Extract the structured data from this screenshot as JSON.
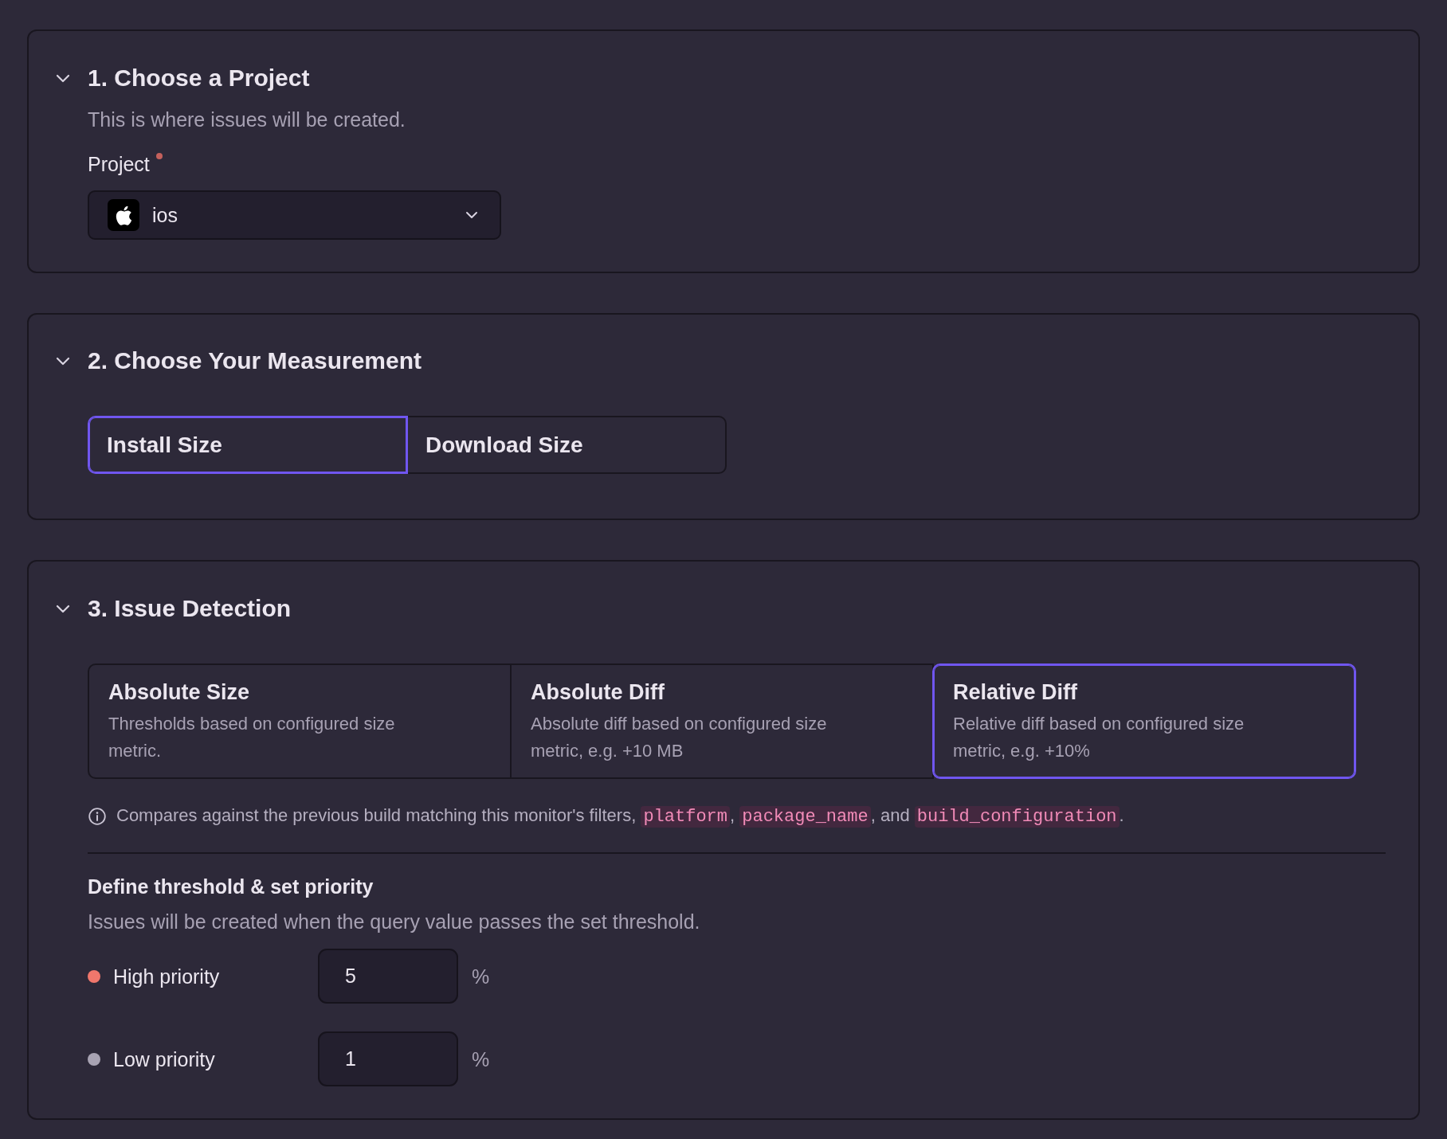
{
  "sections": [
    {
      "kind": "project",
      "title": "1. Choose a Project",
      "expanded": true,
      "description": "This is where issues will be created.",
      "field": {
        "label": "Project",
        "required": true,
        "value": "ios"
      }
    },
    {
      "kind": "measurement",
      "title": "2. Choose Your Measurement",
      "expanded": true,
      "options": [
        {
          "label": "Install Size",
          "selected": true
        },
        {
          "label": "Download Size",
          "selected": false
        }
      ]
    },
    {
      "kind": "detection",
      "title": "3. Issue Detection",
      "expanded": true,
      "options": [
        {
          "title": "Absolute Size",
          "description": "Thresholds based on configured size metric.",
          "selected": false
        },
        {
          "title": "Absolute Diff",
          "description": "Absolute diff based on configured size metric, e.g. +10 MB",
          "selected": false
        },
        {
          "title": "Relative Diff",
          "description": "Relative diff based on configured size metric, e.g. +10%",
          "selected": true
        }
      ],
      "info": [
        {
          "kind": "text",
          "text": "Compares against the previous build matching this monitor's filters, "
        },
        {
          "kind": "code",
          "text": "platform"
        },
        {
          "kind": "text",
          "text": ", "
        },
        {
          "kind": "code",
          "text": "package_name"
        },
        {
          "kind": "text",
          "text": ", and "
        },
        {
          "kind": "code",
          "text": "build_configuration"
        },
        {
          "kind": "text",
          "text": "."
        }
      ],
      "thresholds": {
        "title": "Define threshold & set priority",
        "description": "Issues will be created when the query value passes the set threshold.",
        "rows": [
          {
            "label": "High priority",
            "color": "#f0776c",
            "value": "5",
            "unit": "%"
          },
          {
            "label": "Low priority",
            "color": "#a8a3b3",
            "value": "1",
            "unit": "%"
          }
        ]
      }
    }
  ]
}
